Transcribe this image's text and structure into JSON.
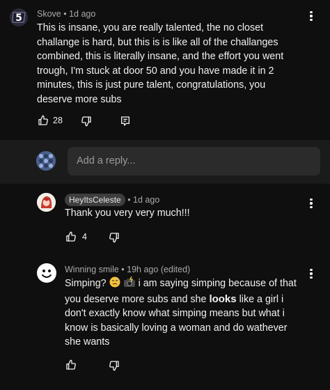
{
  "comments": [
    {
      "author": "Skove",
      "age": "1d ago",
      "text": "This is insane, you are really talented, the no closet challange is hard, but this is is like all of the challanges combined, this is literally insane, and the effort you went trough, I'm stuck at door 50 and you have made it in 2 minutes, this is just pure talent, congratulations, you deserve more subs",
      "likes": "28",
      "avatar_icon": "s-logo-icon"
    }
  ],
  "reply_bar": {
    "placeholder": "Add a reply..."
  },
  "replies": [
    {
      "author": "HeyItsCeleste",
      "age": "1d ago",
      "text": "Thank you very very much!!!",
      "likes": "4",
      "avatar_icon": "anime-avatar-icon"
    },
    {
      "author": "Winning smile",
      "age": "19h ago (edited)",
      "text_prefix": "Simping?",
      "text_mid": " i am saying simping because of that you deserve more subs and she ",
      "text_bold": "looks",
      "text_suffix": " like a girl i don't exactly know what simping means but what i know is basically loving a woman and do wathever she wants",
      "likes": "",
      "avatar_icon": "smiley-face-icon"
    }
  ],
  "colors": {
    "background": "#0f0f0f",
    "reply_bar": "#1b1b1b",
    "input": "#2b2b2b",
    "meta_text": "#aaaaaa"
  }
}
